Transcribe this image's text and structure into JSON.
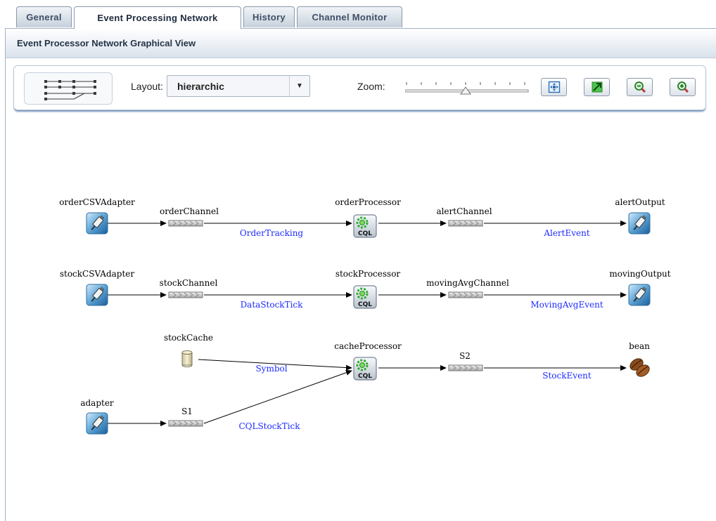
{
  "tabs": [
    {
      "label": "General",
      "active": false
    },
    {
      "label": "Event Processing Network",
      "active": true
    },
    {
      "label": "History",
      "active": false
    },
    {
      "label": "Channel Monitor",
      "active": false
    }
  ],
  "panel": {
    "title": "Event Processor Network Graphical View"
  },
  "toolbar": {
    "layout_label": "Layout:",
    "layout_value": "hierarchic",
    "zoom_label": "Zoom:",
    "zoom_level": 0.5,
    "buttons": [
      {
        "icon": "fit-to-window-icon"
      },
      {
        "icon": "actual-size-icon"
      },
      {
        "icon": "zoom-out-icon"
      },
      {
        "icon": "zoom-in-icon"
      }
    ]
  },
  "graph": {
    "nodes": [
      {
        "id": "orderCSVAdapter",
        "label": "orderCSVAdapter",
        "kind": "adapter"
      },
      {
        "id": "orderChannel",
        "label": "orderChannel",
        "kind": "channel"
      },
      {
        "id": "orderProcessor",
        "label": "orderProcessor",
        "kind": "processor",
        "badge": "CQL"
      },
      {
        "id": "alertChannel",
        "label": "alertChannel",
        "kind": "channel"
      },
      {
        "id": "alertOutput",
        "label": "alertOutput",
        "kind": "adapter"
      },
      {
        "id": "stockCSVAdapter",
        "label": "stockCSVAdapter",
        "kind": "adapter"
      },
      {
        "id": "stockChannel",
        "label": "stockChannel",
        "kind": "channel"
      },
      {
        "id": "stockProcessor",
        "label": "stockProcessor",
        "kind": "processor",
        "badge": "CQL"
      },
      {
        "id": "movingAvgChannel",
        "label": "movingAvgChannel",
        "kind": "channel"
      },
      {
        "id": "movingOutput",
        "label": "movingOutput",
        "kind": "adapter"
      },
      {
        "id": "stockCache",
        "label": "stockCache",
        "kind": "cache"
      },
      {
        "id": "cacheProcessor",
        "label": "cacheProcessor",
        "kind": "processor",
        "badge": "CQL"
      },
      {
        "id": "S2",
        "label": "S2",
        "kind": "channel"
      },
      {
        "id": "bean",
        "label": "bean",
        "kind": "bean"
      },
      {
        "id": "adapter",
        "label": "adapter",
        "kind": "adapter"
      },
      {
        "id": "S1",
        "label": "S1",
        "kind": "channel"
      }
    ],
    "edge_labels": [
      {
        "id": "OrderTracking",
        "label": "OrderTracking"
      },
      {
        "id": "AlertEvent",
        "label": "AlertEvent"
      },
      {
        "id": "DataStockTick",
        "label": "DataStockTick"
      },
      {
        "id": "MovingAvgEvent",
        "label": "MovingAvgEvent"
      },
      {
        "id": "Symbol",
        "label": "Symbol"
      },
      {
        "id": "StockEvent",
        "label": "StockEvent"
      },
      {
        "id": "CQLStockTick",
        "label": "CQLStockTick"
      }
    ]
  }
}
